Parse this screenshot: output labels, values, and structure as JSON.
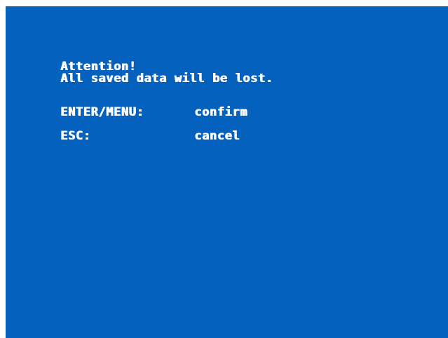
{
  "dialog": {
    "title": "Attention!",
    "message": "All saved data will be lost.",
    "options": [
      {
        "key": "ENTER/MENU:",
        "action": "confirm"
      },
      {
        "key": "ESC:",
        "action": "cancel"
      }
    ]
  },
  "colors": {
    "background": "#0461be",
    "text": "#ffffff"
  }
}
